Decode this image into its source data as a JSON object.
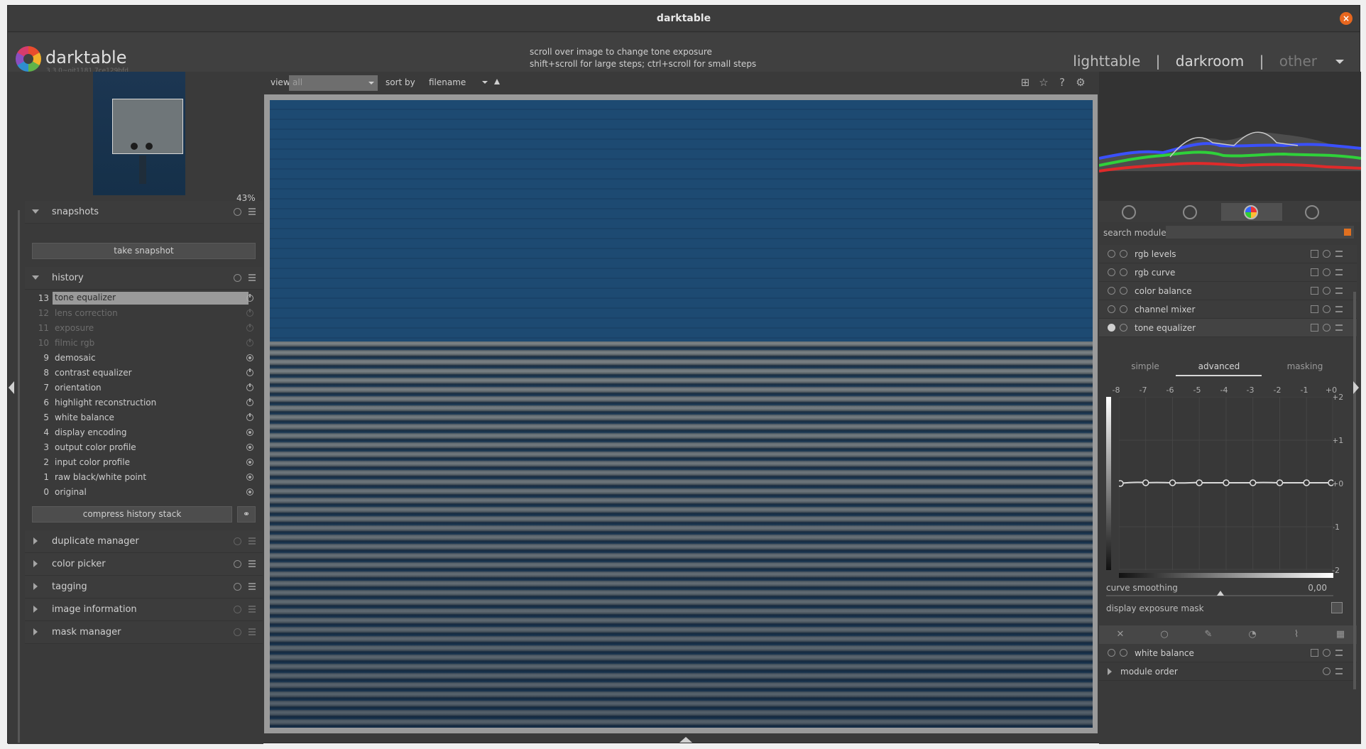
{
  "window": {
    "title": "darktable"
  },
  "header": {
    "logo_text": "darktable",
    "version": "3.3.0~git1181.7ce129bfd",
    "hint_line1": "scroll over image to change tone exposure",
    "hint_line2": "shift+scroll for large steps; ctrl+scroll for small steps",
    "views": [
      "lighttable",
      "darkroom",
      "other"
    ],
    "view_sep": "|"
  },
  "navigation": {
    "zoom": "43%"
  },
  "snapshots": {
    "title": "snapshots",
    "take_label": "take snapshot"
  },
  "history": {
    "title": "history",
    "items": [
      {
        "num": "13",
        "name": "tone equalizer"
      },
      {
        "num": "12",
        "name": "lens correction"
      },
      {
        "num": "11",
        "name": "exposure"
      },
      {
        "num": "10",
        "name": "filmic rgb"
      },
      {
        "num": "9",
        "name": "demosaic"
      },
      {
        "num": "8",
        "name": "contrast equalizer"
      },
      {
        "num": "7",
        "name": "orientation"
      },
      {
        "num": "6",
        "name": "highlight reconstruction"
      },
      {
        "num": "5",
        "name": "white balance"
      },
      {
        "num": "4",
        "name": "display encoding"
      },
      {
        "num": "3",
        "name": "output color profile"
      },
      {
        "num": "2",
        "name": "input color profile"
      },
      {
        "num": "1",
        "name": "raw black/white point"
      },
      {
        "num": "0",
        "name": "original"
      }
    ],
    "compress_label": "compress history stack"
  },
  "left_modules": [
    "duplicate manager",
    "color picker",
    "tagging",
    "image information",
    "mask manager"
  ],
  "toolbar": {
    "view_label": "view",
    "view_value": "all",
    "sort_label": "sort by",
    "sort_value": "filename"
  },
  "right": {
    "search_label": "search module",
    "modules": [
      "rgb levels",
      "rgb curve",
      "color balance",
      "channel mixer",
      "tone equalizer"
    ],
    "tone_equalizer": {
      "tabs": [
        "simple",
        "advanced",
        "masking"
      ],
      "x_labels": [
        "-8",
        "-7",
        "-6",
        "-5",
        "-4",
        "-3",
        "-2",
        "-1",
        "+0"
      ],
      "y_labels": [
        "+2",
        "+1",
        "+0",
        "-1",
        "-2"
      ],
      "curve_smoothing_label": "curve smoothing",
      "curve_smoothing_value": "0,00",
      "display_exposure_mask_label": "display exposure mask"
    },
    "bottom_modules": [
      "white balance",
      "module order"
    ]
  }
}
